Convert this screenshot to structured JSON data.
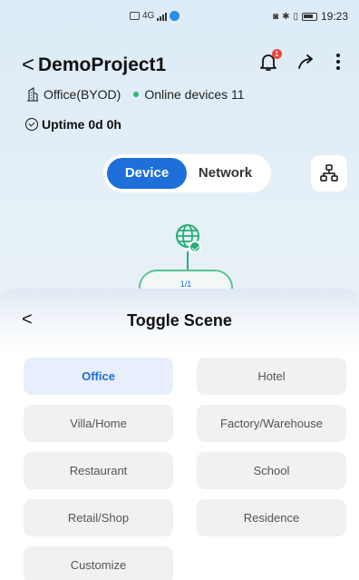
{
  "status_bar": {
    "network_label": "4G",
    "time": "19:23"
  },
  "header": {
    "back_glyph": "<",
    "project_name": "DemoProject1",
    "notification_count": "1"
  },
  "site": {
    "type_label": "Office(BYOD)",
    "online_label": "Online devices 11",
    "uptime_label": "Uptime 0d 0h"
  },
  "segment": {
    "device_label": "Device",
    "network_label": "Network",
    "active": "Device"
  },
  "topology": {
    "node_label": "1/1",
    "status_color": "#27ae77"
  },
  "sheet": {
    "back_glyph": "<",
    "title": "Toggle Scene",
    "selected_scene": "Office",
    "scenes": [
      {
        "label": "Office"
      },
      {
        "label": "Hotel"
      },
      {
        "label": "Villa/Home"
      },
      {
        "label": "Factory/Warehouse"
      },
      {
        "label": "Restaurant"
      },
      {
        "label": "School"
      },
      {
        "label": "Retail/Shop"
      },
      {
        "label": "Residence"
      },
      {
        "label": "Customize"
      }
    ]
  },
  "colors": {
    "accent": "#1e6fd9",
    "online": "#2bb673",
    "badge": "#e84a3f"
  },
  "icons": [
    "building-icon",
    "clock-icon",
    "bell-icon",
    "share-icon",
    "more-icon",
    "topology-icon",
    "globe-icon",
    "check-icon",
    "back-icon"
  ]
}
